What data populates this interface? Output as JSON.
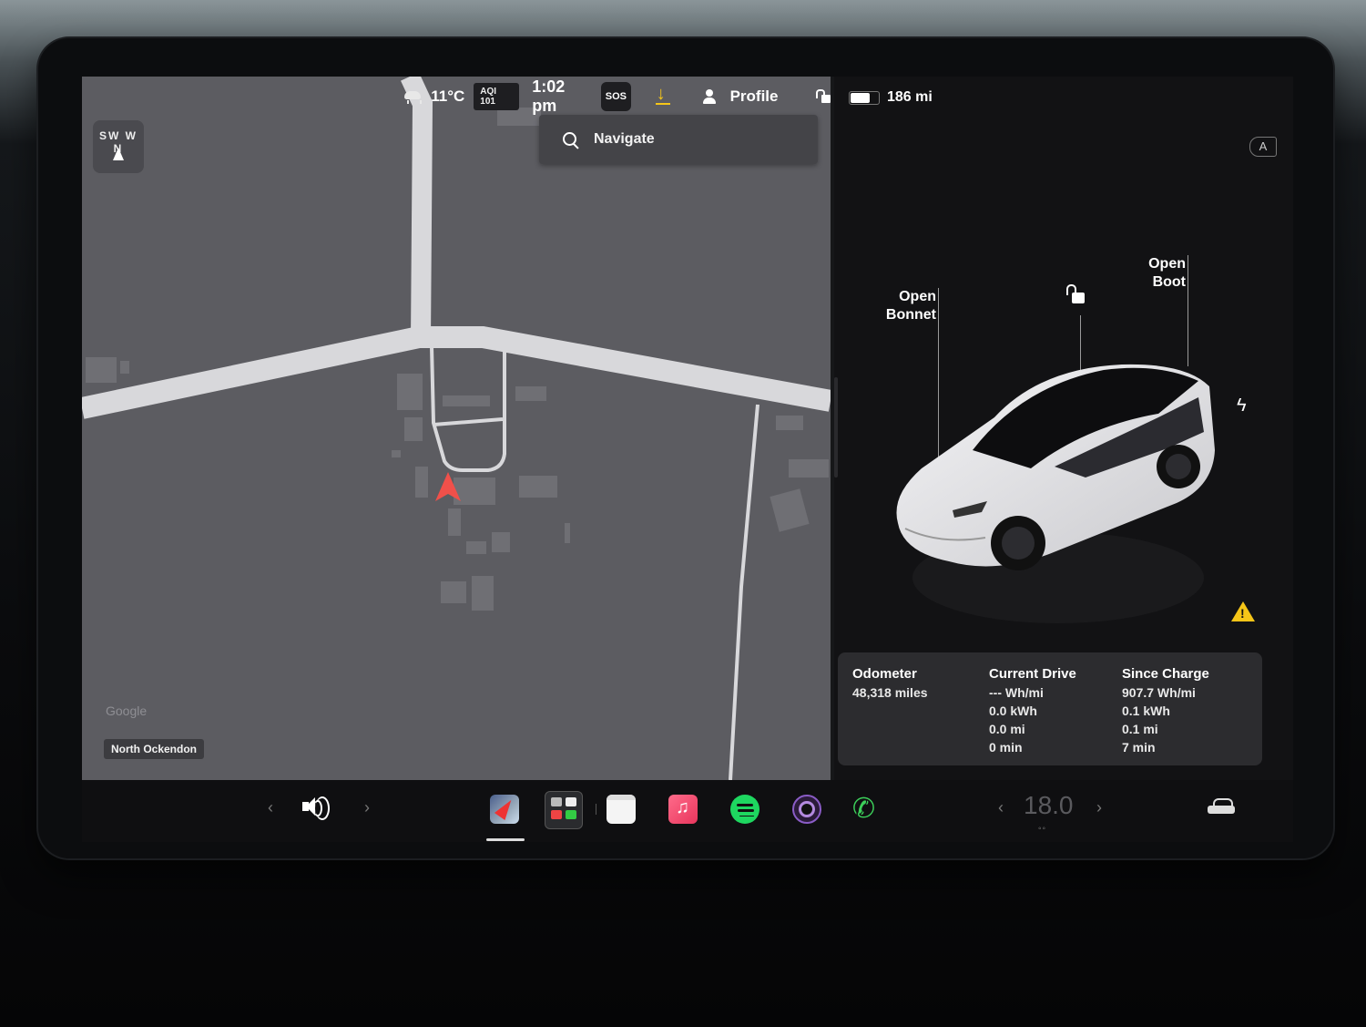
{
  "status": {
    "temperature": "11°C",
    "aqi": "AQI 101",
    "time": "1:02 pm",
    "sos": "SOS",
    "profile": "Profile"
  },
  "search": {
    "placeholder": "Navigate"
  },
  "compass": {
    "letters": "SW W N"
  },
  "map": {
    "attribution": "Google",
    "place_label": "North Ockendon",
    "colors": {
      "background": "#5c5c61",
      "road": "#d8d8db",
      "user_arrow": "#f0504a"
    }
  },
  "vehicle": {
    "range": "186 mi",
    "battery_level_fraction": 0.75,
    "bonnet_label": "Open\nBonnet",
    "boot_label": "Open\nBoot",
    "bonnet_line1": "Open",
    "bonnet_line2": "Bonnet",
    "boot_line1": "Open",
    "boot_line2": "Boot"
  },
  "trip": {
    "odometer": {
      "title": "Odometer",
      "value": "48,318 miles"
    },
    "current_drive": {
      "title": "Current Drive",
      "efficiency": "--- Wh/mi",
      "energy": "0.0 kWh",
      "distance": "0.0 mi",
      "duration": "0 min"
    },
    "since_charge": {
      "title": "Since Charge",
      "efficiency": "907.7 Wh/mi",
      "energy": "0.1 kWh",
      "distance": "0.1 mi",
      "duration": "7 min"
    }
  },
  "dock": {
    "volume_prev": "‹",
    "volume_next": "›",
    "climate_prev": "‹",
    "climate_next": "›",
    "climate_temp": "18.0"
  },
  "icons": {
    "weather": "cloud-rain-icon",
    "download": "download-icon",
    "lock": "unlock-icon",
    "headlights": "auto-headlights-icon",
    "charge": "lightning-icon",
    "warning": "warning-icon"
  },
  "accent_colors": {
    "download": "#f5c518",
    "warning": "#f5c518",
    "spotify": "#1ed760",
    "phone": "#3ccf5a"
  }
}
